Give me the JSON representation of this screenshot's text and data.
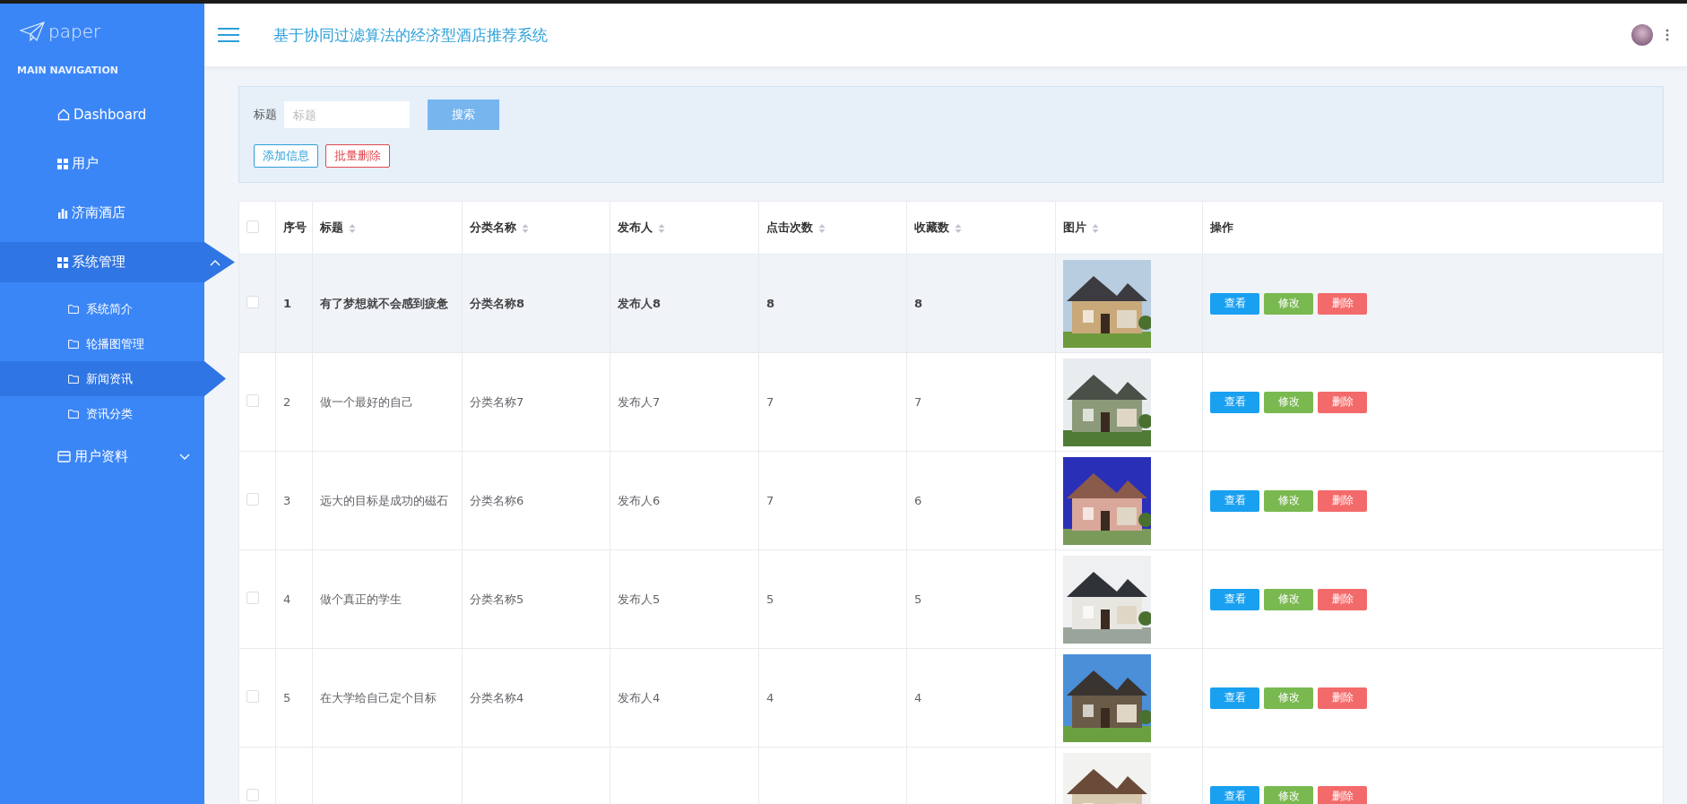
{
  "sidebar": {
    "logo": "paper",
    "section": "MAIN NAVIGATION",
    "items": [
      {
        "label": "Dashboard",
        "selected": false
      },
      {
        "label": "用户",
        "selected": false
      },
      {
        "label": "济南酒店",
        "selected": false
      },
      {
        "label": "系统管理",
        "selected": true,
        "expanded": true,
        "children": [
          {
            "label": "系统简介",
            "selected": false
          },
          {
            "label": "轮播图管理",
            "selected": false
          },
          {
            "label": "新闻资讯",
            "selected": true
          },
          {
            "label": "资讯分类",
            "selected": false
          }
        ]
      },
      {
        "label": "用户资料",
        "selected": false,
        "expanded": false
      }
    ]
  },
  "header": {
    "title": "基于协同过滤算法的经济型酒店推荐系统"
  },
  "search": {
    "label": "标题",
    "placeholder": "标题",
    "button": "搜索",
    "actions": [
      {
        "label": "添加信息",
        "kind": "add"
      },
      {
        "label": "批量删除",
        "kind": "delete"
      }
    ]
  },
  "table": {
    "select_all": {
      "checked": false
    },
    "columns": [
      {
        "label": "序号",
        "sortable": false
      },
      {
        "label": "标题",
        "sortable": true
      },
      {
        "label": "分类名称",
        "sortable": true
      },
      {
        "label": "发布人",
        "sortable": true
      },
      {
        "label": "点击次数",
        "sortable": true
      },
      {
        "label": "收藏数",
        "sortable": true
      },
      {
        "label": "图片",
        "sortable": true
      },
      {
        "label": "操作",
        "sortable": false
      }
    ],
    "rows": [
      {
        "checked": false,
        "hovered": true,
        "index": "1",
        "title": "有了梦想就不会感到疲惫",
        "category": "分类名称8",
        "publisher": "发布人8",
        "clicks": "8",
        "favorites": "8",
        "image": {
          "kind": "picture"
        },
        "actions": [
          {
            "label": "查看",
            "kind": "view"
          },
          {
            "label": "修改",
            "kind": "edit"
          },
          {
            "label": "删除",
            "kind": "delete"
          }
        ]
      },
      {
        "checked": false,
        "hovered": false,
        "index": "2",
        "title": "做一个最好的自己",
        "category": "分类名称7",
        "publisher": "发布人7",
        "clicks": "7",
        "favorites": "7",
        "image": {
          "kind": "picture"
        },
        "actions": [
          {
            "label": "查看",
            "kind": "view"
          },
          {
            "label": "修改",
            "kind": "edit"
          },
          {
            "label": "删除",
            "kind": "delete"
          }
        ]
      },
      {
        "checked": false,
        "hovered": false,
        "index": "3",
        "title": "远大的目标是成功的磁石",
        "category": "分类名称6",
        "publisher": "发布人6",
        "clicks": "7",
        "favorites": "6",
        "image": {
          "kind": "picture"
        },
        "actions": [
          {
            "label": "查看",
            "kind": "view"
          },
          {
            "label": "修改",
            "kind": "edit"
          },
          {
            "label": "删除",
            "kind": "delete"
          }
        ]
      },
      {
        "checked": false,
        "hovered": false,
        "index": "4",
        "title": "做个真正的学生",
        "category": "分类名称5",
        "publisher": "发布人5",
        "clicks": "5",
        "favorites": "5",
        "image": {
          "kind": "picture"
        },
        "actions": [
          {
            "label": "查看",
            "kind": "view"
          },
          {
            "label": "修改",
            "kind": "edit"
          },
          {
            "label": "删除",
            "kind": "delete"
          }
        ]
      },
      {
        "checked": false,
        "hovered": false,
        "index": "5",
        "title": "在大学给自己定个目标",
        "category": "分类名称4",
        "publisher": "发布人4",
        "clicks": "4",
        "favorites": "4",
        "image": {
          "kind": "picture"
        },
        "actions": [
          {
            "label": "查看",
            "kind": "view"
          },
          {
            "label": "修改",
            "kind": "edit"
          },
          {
            "label": "删除",
            "kind": "delete"
          }
        ]
      },
      {
        "checked": false,
        "hovered": false,
        "image": {
          "kind": "picture"
        },
        "actions": [
          {
            "label": "查看",
            "kind": "view"
          },
          {
            "label": "修改",
            "kind": "edit"
          },
          {
            "label": "删除",
            "kind": "delete"
          }
        ]
      }
    ]
  }
}
